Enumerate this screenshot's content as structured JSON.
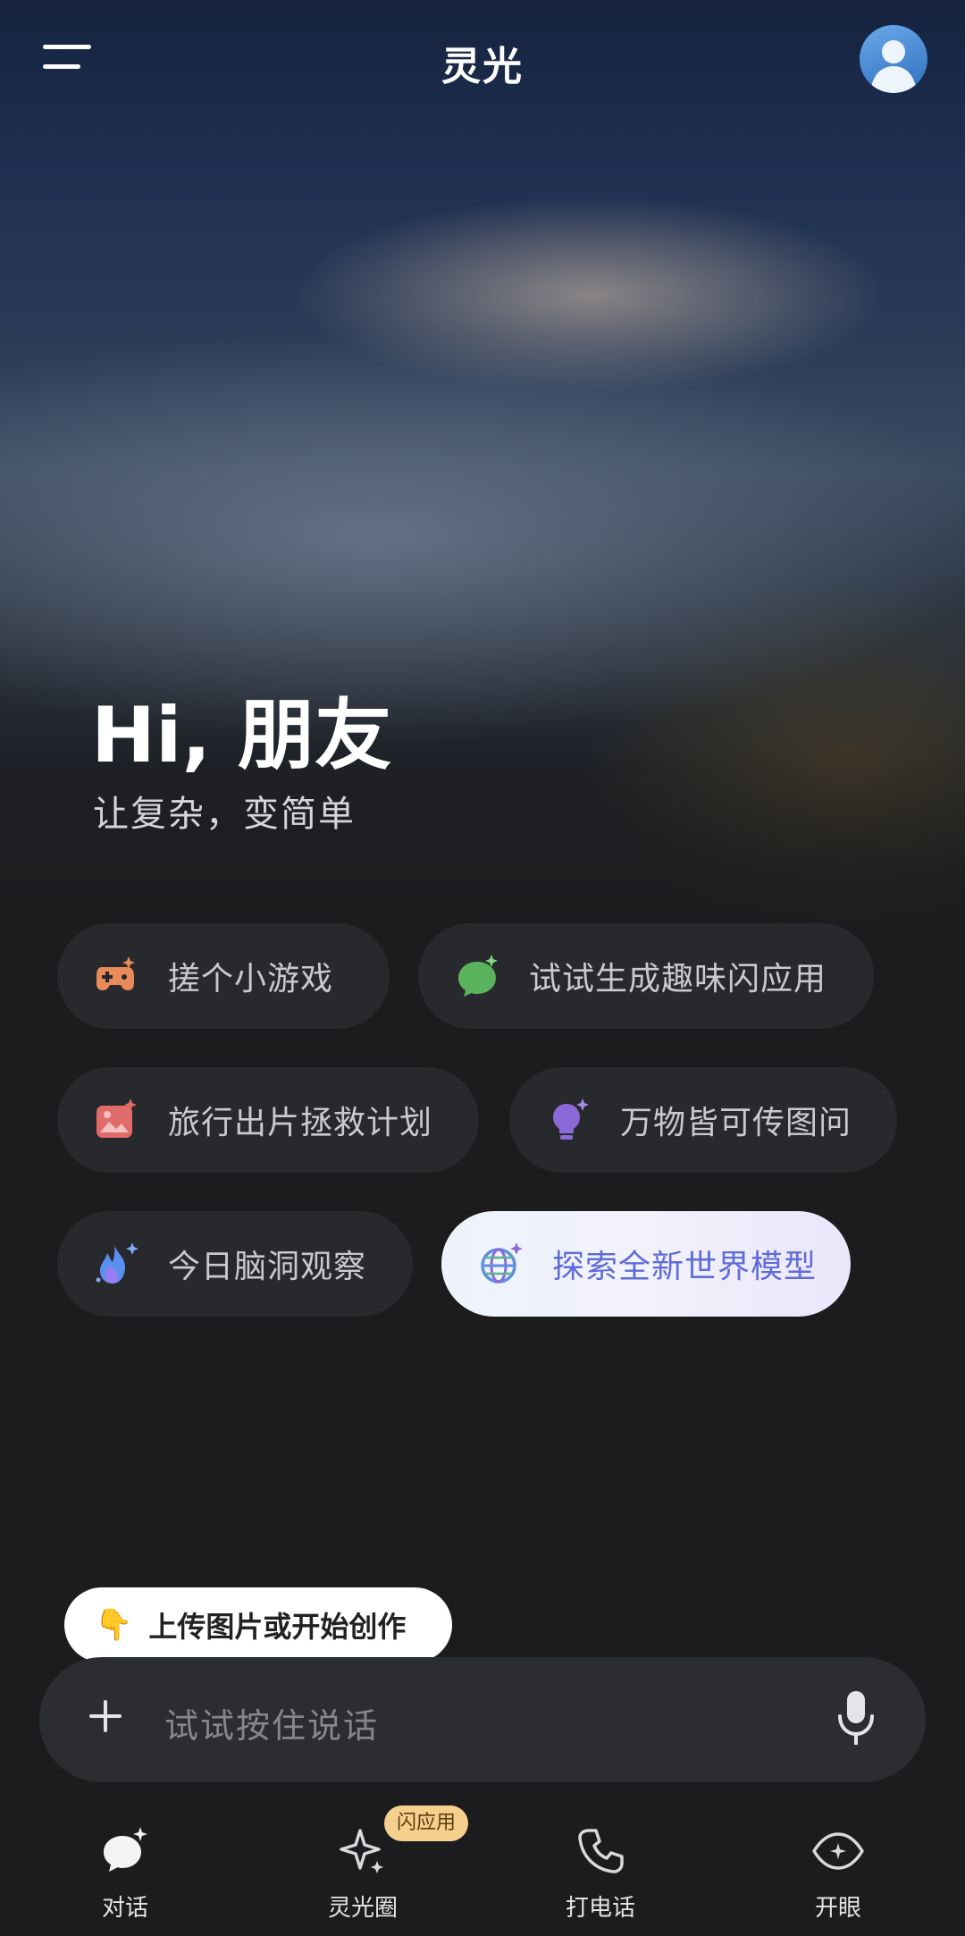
{
  "header": {
    "title": "灵光",
    "menu_icon": "menu-icon",
    "avatar_icon": "user-avatar-icon"
  },
  "hero": {
    "greeting": "Hi, 朋友",
    "subtitle": "让复杂，变简单"
  },
  "suggestions": [
    {
      "label": "搓个小游戏",
      "icon": "gamepad-icon",
      "color": "#e98a5a"
    },
    {
      "label": "试试生成趣味闪应用",
      "icon": "chat-spark-icon",
      "color": "#5ab35c"
    },
    {
      "label": "旅行出片拯救计划",
      "icon": "photo-icon",
      "color": "#e06b6b"
    },
    {
      "label": "万物皆可传图问",
      "icon": "lightbulb-icon",
      "color": "#8c69d8"
    },
    {
      "label": "今日脑洞观察",
      "icon": "flame-icon",
      "color": "#5b8ff0"
    },
    {
      "label": "探索全新世界模型",
      "icon": "globe-icon",
      "color": "#5e6cd8"
    }
  ],
  "tooltip": {
    "icon": "👇",
    "text": "上传图片或开始创作"
  },
  "input": {
    "placeholder": "试试按住说话",
    "plus_icon": "plus-icon",
    "mic_icon": "microphone-icon"
  },
  "tabs": [
    {
      "label": "对话",
      "icon": "chat-icon"
    },
    {
      "label": "灵光圈",
      "icon": "sparkle-icon",
      "badge": "闪应用"
    },
    {
      "label": "打电话",
      "icon": "phone-icon"
    },
    {
      "label": "开眼",
      "icon": "eye-icon"
    }
  ],
  "colors": {
    "background": "#1c1c1e",
    "chip_bg": "#28292d",
    "accent": "#5e6cd8",
    "badge_bg": "#f5d08d"
  }
}
